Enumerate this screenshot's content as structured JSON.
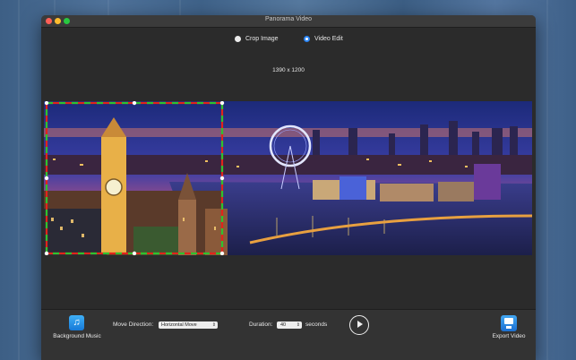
{
  "window": {
    "title": "Panorama Video"
  },
  "mode": {
    "options": [
      {
        "label": "Crop Image",
        "selected": false
      },
      {
        "label": "Video Edit",
        "selected": true
      }
    ]
  },
  "canvas": {
    "dimensions": "1390 x 1200",
    "crop_colors": {
      "primary": "#e0251b",
      "secondary": "#2fc22f"
    }
  },
  "toolbar": {
    "music_label": "Background Music",
    "direction_label": "Move Direction:",
    "direction_value": "Horizontal Move",
    "duration_label": "Duration:",
    "duration_value": "40",
    "duration_unit": "seconds",
    "export_label": "Export Video"
  },
  "colors": {
    "window_bg": "#2b2b2b",
    "accent": "#2c86f5"
  }
}
